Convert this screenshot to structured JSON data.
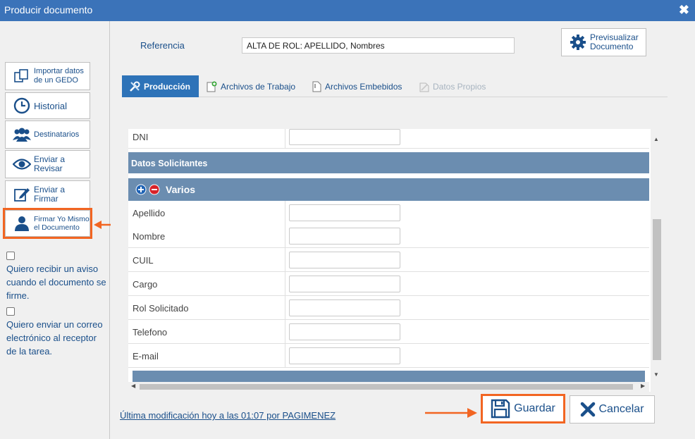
{
  "window": {
    "title": "Producir documento",
    "close_glyph": "✖"
  },
  "sidebar": {
    "buttons": [
      {
        "name": "importar",
        "label_line1": "Importar datos",
        "label_line2": "de un GEDO",
        "icon": "copy-icon"
      },
      {
        "name": "historial",
        "label_line1": "Historial",
        "label_line2": "",
        "icon": "clock-icon"
      },
      {
        "name": "destinatarios",
        "label_line1": "Destinatarios",
        "label_line2": "",
        "icon": "users-icon"
      },
      {
        "name": "enviar-revisar",
        "label_line1": "Enviar a",
        "label_line2": "Revisar",
        "icon": "eye-icon"
      },
      {
        "name": "enviar-firmar",
        "label_line1": "Enviar a",
        "label_line2": "Firmar",
        "icon": "pencil-icon"
      },
      {
        "name": "firmar-yo-mismo",
        "label_line1": "Firmar Yo Mismo",
        "label_line2": "el Documento",
        "icon": "user-icon"
      }
    ],
    "checkbox1_text": "Quiero recibir un aviso cuando el documento se firme.",
    "checkbox2_text": "Quiero enviar un correo electrónico al receptor de la tarea."
  },
  "main": {
    "referencia_label": "Referencia",
    "referencia_value": "ALTA DE ROL: APELLIDO, Nombres",
    "preview_line1": "Previsualizar",
    "preview_line2": "Documento",
    "tabs": [
      {
        "label": "Producción",
        "state": "active",
        "icon": "tools-icon"
      },
      {
        "label": "Archivos de Trabajo",
        "state": "normal",
        "icon": "add-file-icon"
      },
      {
        "label": "Archivos Embebidos",
        "state": "normal",
        "icon": "attach-file-icon"
      },
      {
        "label": "Datos Propios",
        "state": "disabled",
        "icon": "file-icon"
      }
    ],
    "form": {
      "top_row_label": "DNI",
      "section_title": "Datos Solicitantes",
      "group_title": "Varios",
      "fields": [
        "Apellido",
        "Nombre",
        "CUIL",
        "Cargo",
        "Rol Solicitado",
        "Telefono",
        "E-mail"
      ]
    },
    "last_modified": "Última modificación hoy a las 01:07 por PAGIMENEZ",
    "save_label": "Guardar",
    "cancel_label": "Cancelar"
  },
  "colors": {
    "titlebar": "#3b73b9",
    "accent": "#2e73b8",
    "highlight": "#f26522",
    "section": "#6b8db0"
  }
}
